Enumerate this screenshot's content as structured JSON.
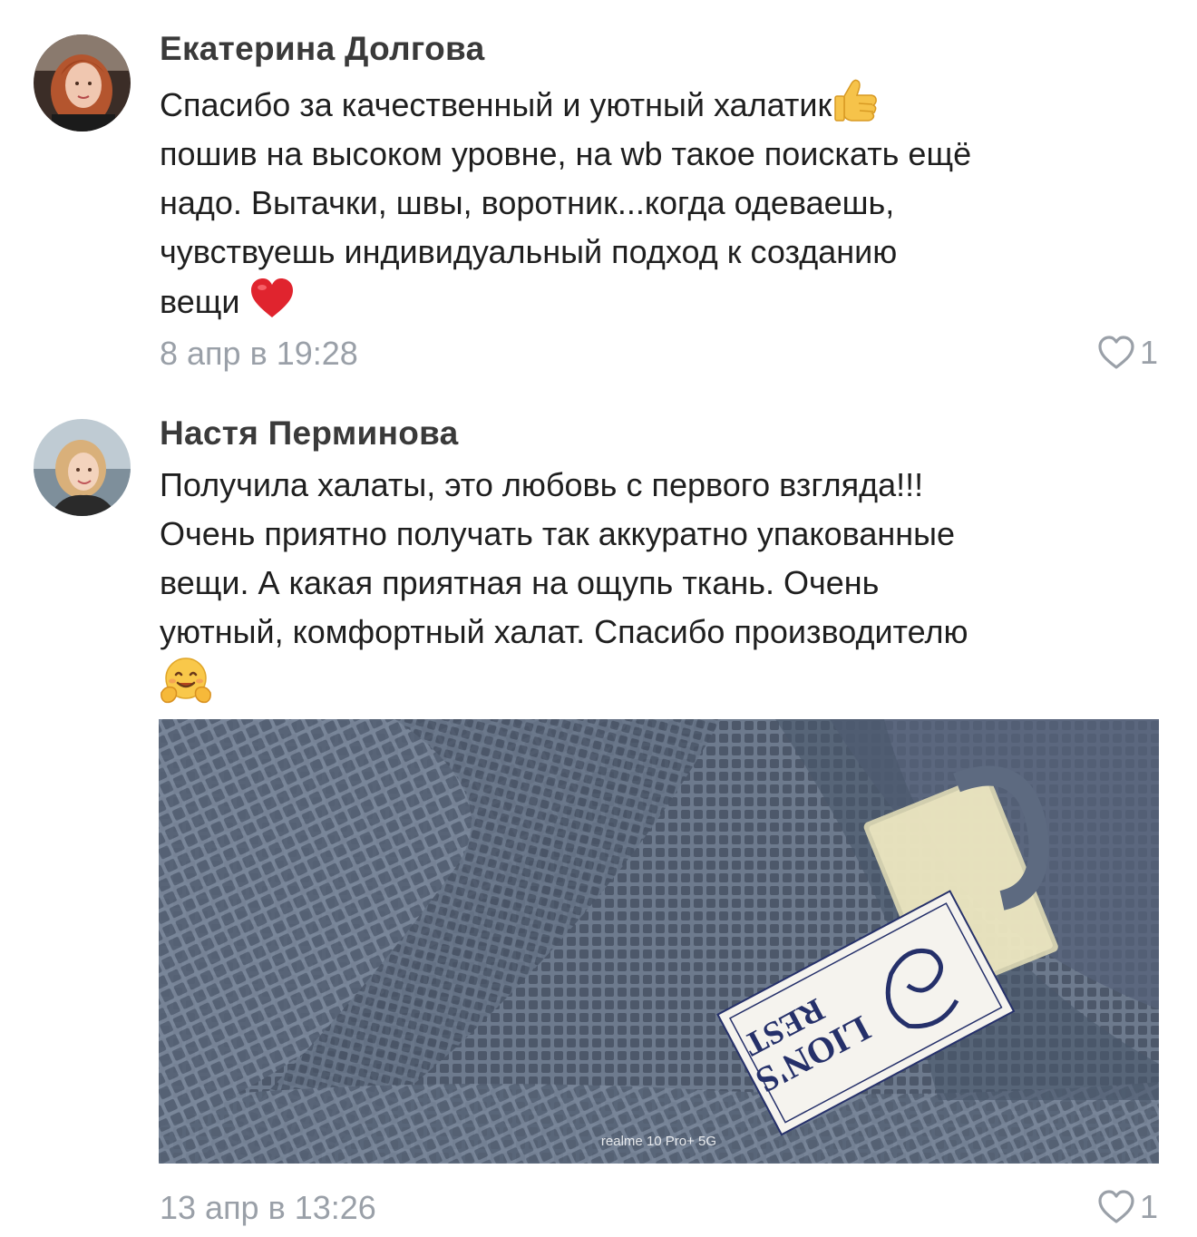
{
  "comments": [
    {
      "author": "Екатерина Долгова",
      "lines": [
        "Спасибо за качественный и уютный халатик",
        "пошив на высоком уровне, на wb такое поискать ещё",
        "надо. Вытачки, швы, воротник...когда одеваешь,",
        "чувствуешь индивидуальный подход к созданию",
        "вещи"
      ],
      "emojis": [
        "thumbs-up-icon",
        "red-heart-icon"
      ],
      "date": "8 апр в 19:28",
      "likes": "1"
    },
    {
      "author": "Настя Перминова",
      "lines": [
        "Получила халаты, это любовь с первого взгляда!!!",
        "Очень приятно получать так аккуратно упакованные",
        "вещи. А какая приятная на ощупь ткань.  Очень",
        "уютный, комфортный халат. Спасибо производителю"
      ],
      "emojis": [
        "hugging-face-icon"
      ],
      "photo": {
        "label_line1": "LION'S",
        "label_line2": "REST",
        "watermark": "realme 10 Pro+ 5G"
      },
      "date": "13 апр в 13:26",
      "likes": "1"
    }
  ],
  "colors": {
    "author": "#3a3a3a",
    "text": "#1f1f1f",
    "meta": "#9aa0a8",
    "fabric": "#5f6c80"
  }
}
